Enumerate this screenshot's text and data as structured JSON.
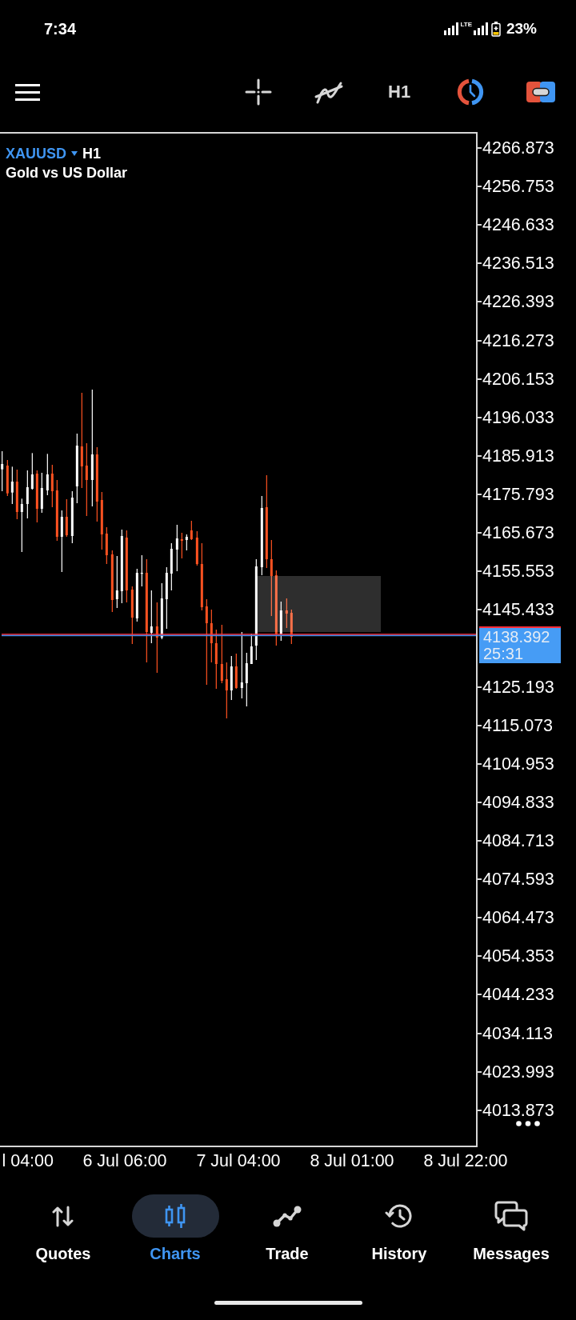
{
  "status_bar": {
    "time": "7:34",
    "network": "LTE",
    "battery": "23%"
  },
  "toolbar": {
    "timeframe": "H1"
  },
  "chart": {
    "symbol": "XAUUSD",
    "timeframe": "H1",
    "description": "Gold vs US Dollar"
  },
  "price_axis": [
    {
      "kind": "tick",
      "label": "4266.873"
    },
    {
      "kind": "tick",
      "label": "4256.753"
    },
    {
      "kind": "tick",
      "label": "4246.633"
    },
    {
      "kind": "tick",
      "label": "4236.513"
    },
    {
      "kind": "tick",
      "label": "4226.393"
    },
    {
      "kind": "tick",
      "label": "4216.273"
    },
    {
      "kind": "tick",
      "label": "4206.153"
    },
    {
      "kind": "tick",
      "label": "4196.033"
    },
    {
      "kind": "tick",
      "label": "4185.913"
    },
    {
      "kind": "tick",
      "label": "4175.793"
    },
    {
      "kind": "tick",
      "label": "4165.673"
    },
    {
      "kind": "tick",
      "label": "4155.553"
    },
    {
      "kind": "tick",
      "label": "4145.433"
    },
    {
      "kind": "current",
      "price": "4138.392",
      "countdown": "25:31"
    },
    {
      "kind": "tick",
      "label": "4125.193"
    },
    {
      "kind": "tick",
      "label": "4115.073"
    },
    {
      "kind": "tick",
      "label": "4104.953"
    },
    {
      "kind": "tick",
      "label": "4094.833"
    },
    {
      "kind": "tick",
      "label": "4084.713"
    },
    {
      "kind": "tick",
      "label": "4074.593"
    },
    {
      "kind": "tick",
      "label": "4064.473"
    },
    {
      "kind": "tick",
      "label": "4054.353"
    },
    {
      "kind": "tick",
      "label": "4044.233"
    },
    {
      "kind": "tick",
      "label": "4034.113"
    },
    {
      "kind": "tick",
      "label": "4023.993"
    },
    {
      "kind": "tick",
      "label": "4013.873"
    }
  ],
  "time_axis": [
    "l 04:00",
    "6 Jul 06:00",
    "7 Jul 04:00",
    "8 Jul 01:00",
    "8 Jul 22:00"
  ],
  "nav": [
    {
      "label": "Quotes",
      "selected": false
    },
    {
      "label": "Charts",
      "selected": true
    },
    {
      "label": "Trade",
      "selected": false
    },
    {
      "label": "History",
      "selected": false
    },
    {
      "label": "Messages",
      "selected": false
    }
  ]
}
